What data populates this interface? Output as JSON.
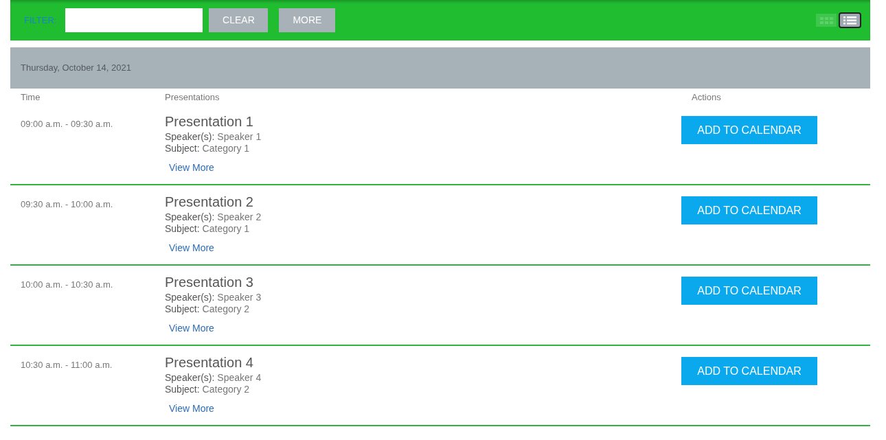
{
  "toolbar": {
    "filter": {
      "label": "FILTER:"
    },
    "buttons": [
      "CLEAR",
      "MORE"
    ],
    "view_modes": [
      {
        "kind": "grid",
        "selected": false
      },
      {
        "kind": "list",
        "selected": true
      }
    ]
  },
  "schedule": {
    "date": "Thursday, October 14, 2021",
    "columns": [
      "Time",
      "Presentations",
      "Actions"
    ],
    "rows": [
      {
        "time": "09:00 a.m. - 09:30 a.m.",
        "title": "Presentation 1",
        "speaker_label": "Speaker(s):",
        "speaker": "Speaker 1",
        "subject_label": "Subject:",
        "subject": "Category 1",
        "link": "View More",
        "action": "ADD TO CALENDAR"
      },
      {
        "time": "09:30 a.m. - 10:00 a.m.",
        "title": "Presentation 2",
        "speaker_label": "Speaker(s):",
        "speaker": "Speaker 2",
        "subject_label": "Subject:",
        "subject": "Category 1",
        "link": "View More",
        "action": "ADD TO CALENDAR"
      },
      {
        "time": "10:00 a.m. - 10:30 a.m.",
        "title": "Presentation 3",
        "speaker_label": "Speaker(s):",
        "speaker": "Speaker 3",
        "subject_label": "Subject:",
        "subject": "Category 2",
        "link": "View More",
        "action": "ADD TO CALENDAR"
      },
      {
        "time": "10:30 a.m. - 11:00 a.m.",
        "title": "Presentation 4",
        "speaker_label": "Speaker(s):",
        "speaker": "Speaker 4",
        "subject_label": "Subject:",
        "subject": "Category 2",
        "link": "View More",
        "action": "ADD TO CALENDAR"
      }
    ]
  }
}
